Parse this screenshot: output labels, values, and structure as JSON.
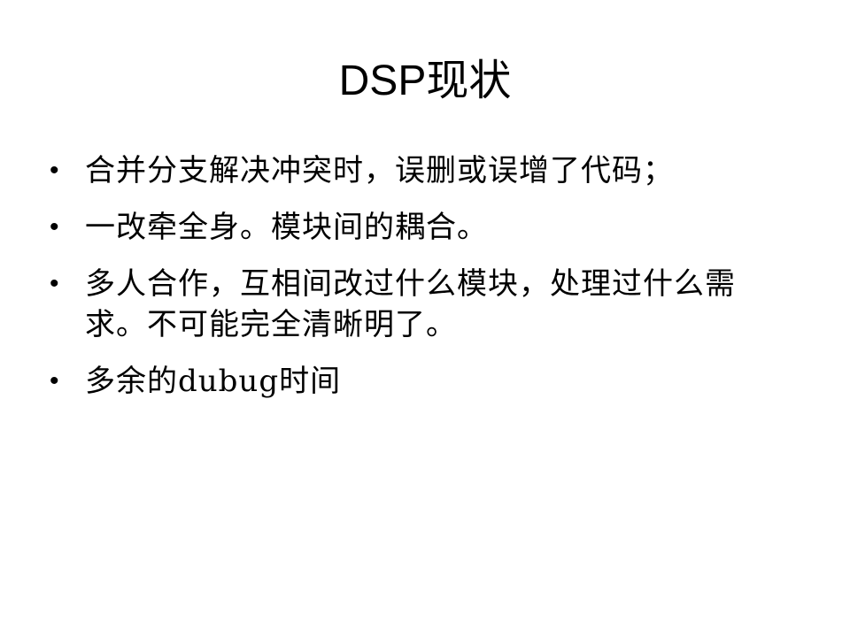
{
  "slide": {
    "title": "DSP现状",
    "bullet_symbol": "•",
    "bullets": [
      "合并分支解决冲突时，误删或误增了代码；",
      "一改牵全身。模块间的耦合。",
      "多人合作，互相间改过什么模块，处理过什么需求。不可能完全清晰明了。",
      "多余的dubug时间"
    ]
  }
}
